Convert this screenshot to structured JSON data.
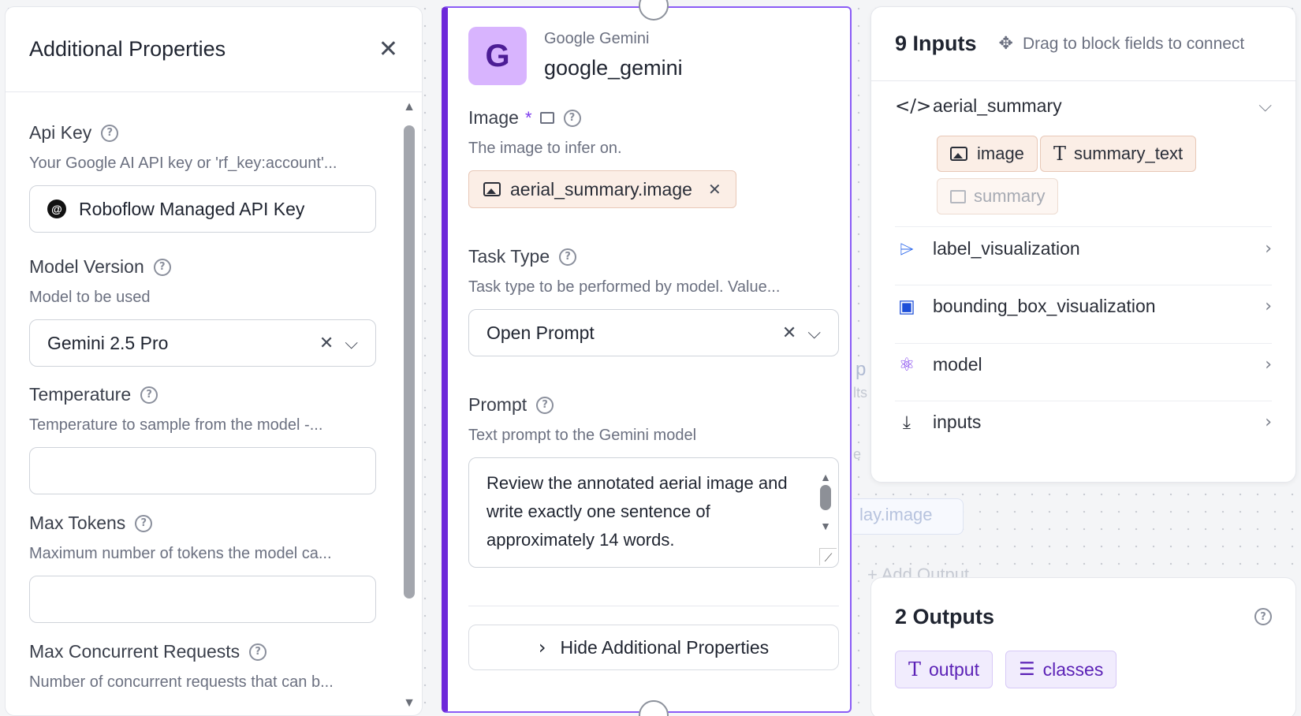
{
  "left_panel": {
    "title": "Additional Properties",
    "fields": [
      {
        "label": "Api Key",
        "description": "Your Google AI API key or 'rf_key:account'...",
        "value": "Roboflow Managed API Key"
      },
      {
        "label": "Model Version",
        "description": "Model to be used",
        "value": "Gemini 2.5 Pro"
      },
      {
        "label": "Temperature",
        "description": "Temperature to sample from the model -...",
        "value": ""
      },
      {
        "label": "Max Tokens",
        "description": "Maximum number of tokens the model ca...",
        "value": ""
      },
      {
        "label": "Max Concurrent Requests",
        "description": "Number of concurrent requests that can b..."
      }
    ]
  },
  "node": {
    "vendor": "Google Gemini",
    "name": "google_gemini",
    "avatar_letter": "G",
    "image_field": {
      "label": "Image",
      "required_mark": "*",
      "description": "The image to infer on.",
      "value": "aerial_summary.image"
    },
    "task_type": {
      "label": "Task Type",
      "description": "Task type to be performed by model. Value...",
      "value": "Open Prompt"
    },
    "prompt": {
      "label": "Prompt",
      "description": "Text prompt to the Gemini model",
      "value": "Review the annotated aerial image and write exactly one sentence of approximately 14 words."
    },
    "toggle_label": "Hide Additional Properties"
  },
  "background": {
    "frag_image": "lay.image",
    "frag_add": "+ Add Output",
    "frag_p": "p",
    "frag_lts": "lts",
    "frag_e": "e"
  },
  "inputs_panel": {
    "count_label": "9 Inputs",
    "hint": "Drag to block fields to connect",
    "groups": [
      {
        "name": "aerial_summary",
        "icon": "code-icon",
        "fields": [
          "image",
          "summary_text",
          "summary"
        ]
      },
      {
        "name": "label_visualization",
        "icon": "tag-icon"
      },
      {
        "name": "bounding_box_visualization",
        "icon": "bbox-icon"
      },
      {
        "name": "model",
        "icon": "model-icon"
      },
      {
        "name": "inputs",
        "icon": "download-icon"
      }
    ]
  },
  "outputs_panel": {
    "count_label": "2 Outputs",
    "outputs": [
      "output",
      "classes"
    ]
  },
  "colors": {
    "accent": "#6d28d9",
    "chip_orange": "#fbeee6",
    "chip_purple": "#f1ecfd"
  }
}
